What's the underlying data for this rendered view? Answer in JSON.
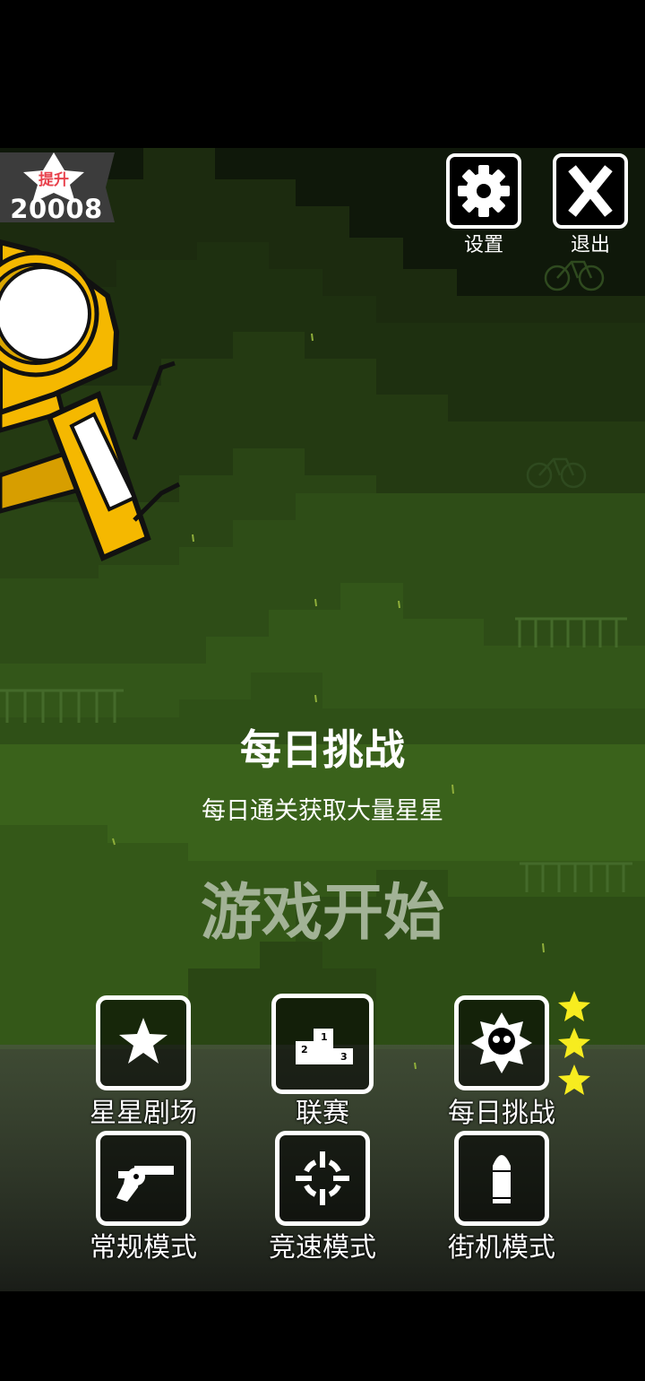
{
  "player": {
    "badge_label": "提升",
    "star_count": "20008"
  },
  "top_buttons": {
    "settings_label": "设置",
    "exit_label": "退出"
  },
  "banner": {
    "title": "每日挑战",
    "subtitle": "每日通关获取大量星星",
    "start_label": "游戏开始"
  },
  "modes": {
    "star_theater": "星星剧场",
    "league": "联赛",
    "daily_challenge": "每日挑战",
    "normal_mode": "常规模式",
    "speed_mode": "竞速模式",
    "arcade_mode": "街机模式"
  },
  "icons": {
    "settings": "gear-icon",
    "exit": "x-icon",
    "star_theater": "star-icon",
    "league": "podium-icon",
    "daily_challenge": "skull-badge-icon",
    "normal_mode": "revolver-icon",
    "speed_mode": "crosshair-icon",
    "arcade_mode": "bullet-icon"
  },
  "daily_challenge_stars": 3,
  "colors": {
    "accent_star": "#f7ec1f",
    "badge_text": "#e8414c",
    "character_yellow": "#f5b800"
  }
}
